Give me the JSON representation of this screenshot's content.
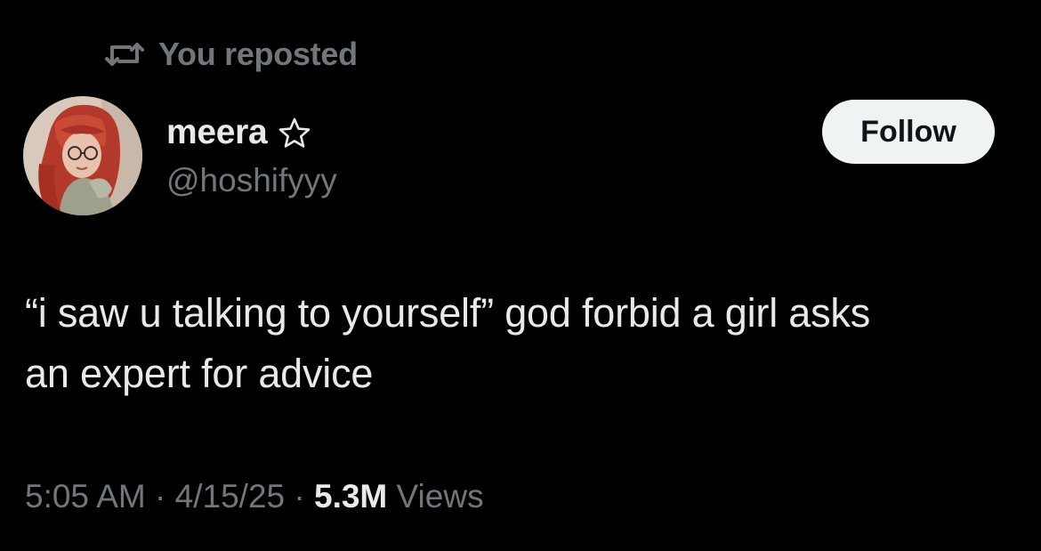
{
  "repost": {
    "icon": "repost-icon",
    "label": "You reposted"
  },
  "author": {
    "avatar": "profile-avatar",
    "display_name": "meera",
    "badge_icon": "star-outline-icon",
    "handle": "@hoshifyyy"
  },
  "follow_button": {
    "label": "Follow"
  },
  "tweet": {
    "text_line1": "“i saw u talking to yourself” god forbid a girl asks",
    "text_line2": "an expert for advice"
  },
  "meta": {
    "time": "5:05 AM",
    "separator": " · ",
    "date": "4/15/25",
    "views_count": "5.3M",
    "views_label": " Views"
  },
  "colors": {
    "background": "#000000",
    "primary_text": "#e7e9ea",
    "secondary_text": "#71767b",
    "follow_bg": "#eff3f4"
  }
}
